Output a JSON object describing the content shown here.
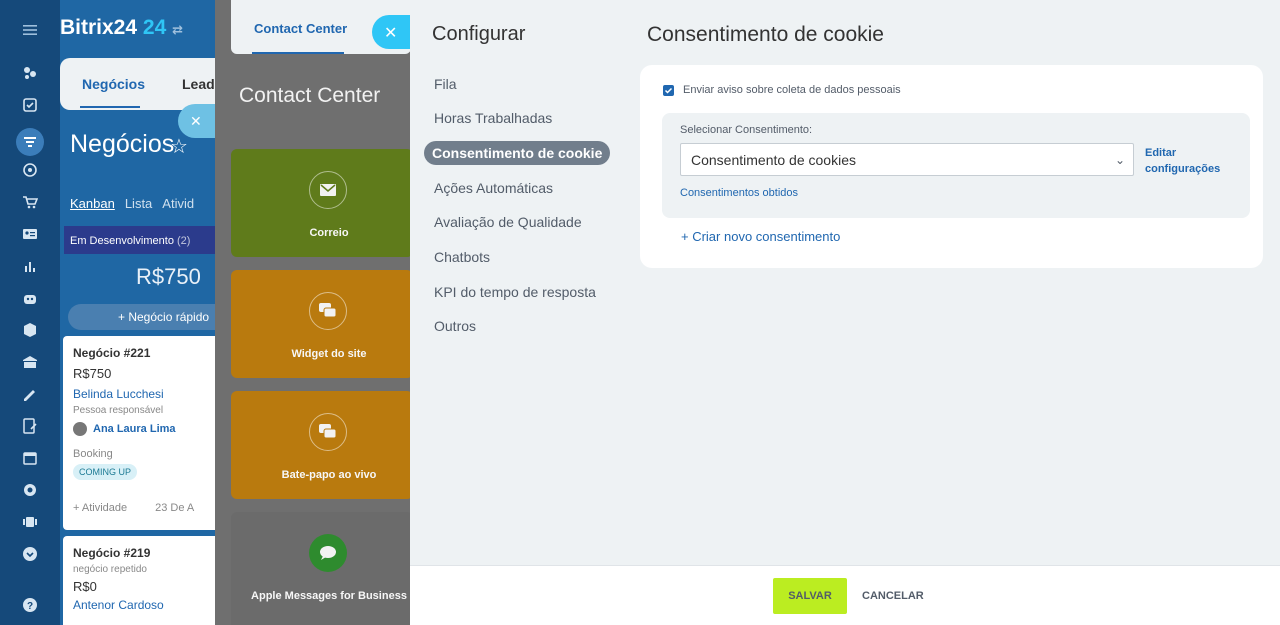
{
  "app": {
    "logo_text": "Bitrix24",
    "logo_num": "24",
    "logo_arrow": "⇄"
  },
  "crm": {
    "tabs": [
      "Negócios",
      "Leads"
    ],
    "page_title": "Negócios",
    "views": [
      "Kanban",
      "Lista",
      "Ativid"
    ],
    "stage": {
      "name": "Em Desenvolvimento",
      "count": "(2)",
      "amount": "R$750"
    },
    "quick_deal": "+ Negócio rápido",
    "deals": [
      {
        "title": "Negócio #221",
        "amount": "R$750",
        "client": "Belinda Lucchesi",
        "role": "Pessoa responsável",
        "person": "Ana Laura Lima",
        "booking": "Booking",
        "badge": "COMING UP",
        "activity": "+ Atividade",
        "date": "23 De A"
      },
      {
        "title": "Negócio #219",
        "subtitle": "negócio repetido",
        "amount": "R$0",
        "client": "Antenor Cardoso"
      }
    ]
  },
  "contact_center": {
    "tab": "Contact Center",
    "title": "Contact Center",
    "cards": [
      {
        "label": "Correio",
        "color": "#5f7b1b",
        "icon": "envelope-icon"
      },
      {
        "label": "Widget do site",
        "color": "#b97a0e",
        "icon": "chat-icon"
      },
      {
        "label": "Bate-papo ao vivo",
        "color": "#b97a0e",
        "icon": "chat-icon"
      },
      {
        "label": "Apple Messages for Business",
        "color": "#6b6b6b",
        "icon": "message-bubble-icon"
      }
    ]
  },
  "settings": {
    "sidebar_title": "Configurar",
    "menu": [
      {
        "label": "Fila",
        "active": false
      },
      {
        "label": "Horas Trabalhadas",
        "active": false
      },
      {
        "label": "Consentimento de cookie",
        "active": true
      },
      {
        "label": "Ações Automáticas",
        "active": false
      },
      {
        "label": "Avaliação de Qualidade",
        "active": false
      },
      {
        "label": "Chatbots",
        "active": false
      },
      {
        "label": "KPI do tempo de resposta",
        "active": false
      },
      {
        "label": "Outros",
        "active": false
      }
    ],
    "content_title": "Consentimento de cookie",
    "checkbox_label": "Enviar aviso sobre coleta de dados pessoais",
    "checkbox_checked": true,
    "select_label": "Selecionar Consentimento:",
    "select_value": "Consentimento de cookies",
    "edit_link_line1": "Editar",
    "edit_link_line2": "configurações",
    "obtained_link": "Consentimentos obtidos",
    "create_link": "+ Criar novo consentimento",
    "save_button": "SALVAR",
    "cancel_button": "CANCELAR"
  }
}
